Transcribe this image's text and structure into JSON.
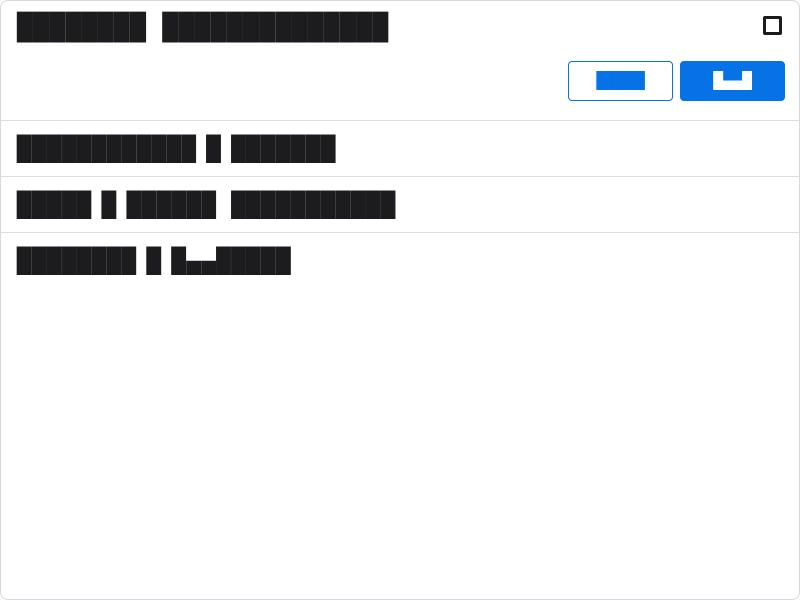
{
  "header": {
    "title": "████████ ██████████████",
    "checkbox_checked": false,
    "secondary_button_label": "█████",
    "primary_button_label": "█▄▄█"
  },
  "rows": [
    {
      "label": "████████████",
      "separator": "█",
      "value": "███████"
    },
    {
      "label": "█████",
      "separator": "█",
      "value": "██████ ███████████"
    },
    {
      "label": "████████",
      "separator": "█",
      "value": "█▄▄█████"
    }
  ],
  "colors": {
    "accent": "#0672e6",
    "text": "#1c1c1e",
    "border": "#d8d8dc",
    "background": "#ffffff"
  }
}
